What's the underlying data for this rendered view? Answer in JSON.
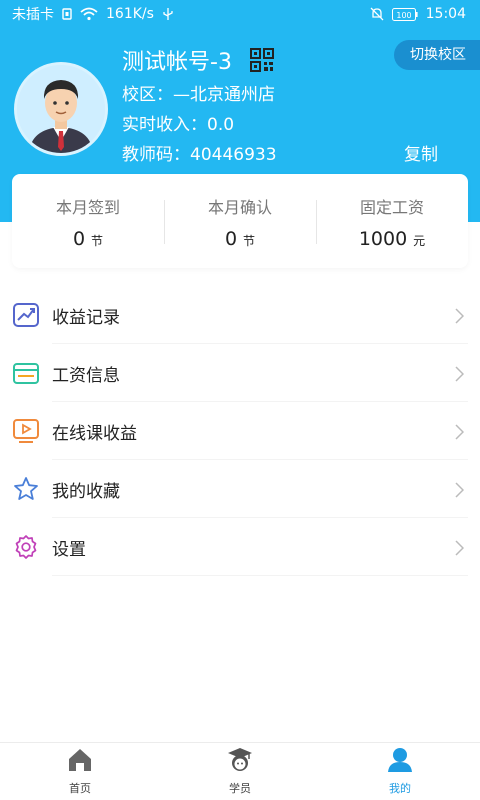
{
  "status_bar": {
    "carrier": "未插卡",
    "speed": "161K/s",
    "battery": "100",
    "time": "15:04",
    "icons": [
      "sim-icon",
      "wifi-icon",
      "usb-icon",
      "mute-icon",
      "battery-icon"
    ]
  },
  "profile": {
    "name": "测试帐号-3",
    "switch_label": "切换校区",
    "campus": "校区：—北京通州店",
    "income": "实时收入：0.0",
    "teacher_code": "教师码：40446933",
    "copy_label": "复制",
    "avatar_icon": "teacher-avatar",
    "qr_icon": "qr-code-icon"
  },
  "stats": [
    {
      "label": "本月签到",
      "value": "0",
      "unit": "节"
    },
    {
      "label": "本月确认",
      "value": "0",
      "unit": "节"
    },
    {
      "label": "固定工资",
      "value": "1000",
      "unit": "元"
    }
  ],
  "menu": [
    {
      "label": "收益记录",
      "icon": "trend-chart-icon"
    },
    {
      "label": "工资信息",
      "icon": "wallet-icon"
    },
    {
      "label": "在线课收益",
      "icon": "video-play-icon"
    },
    {
      "label": "我的收藏",
      "icon": "star-icon"
    },
    {
      "label": "设置",
      "icon": "gear-icon"
    }
  ],
  "tabs": [
    {
      "label": "首页",
      "icon": "home-icon"
    },
    {
      "label": "学员",
      "icon": "student-icon"
    },
    {
      "label": "我的",
      "icon": "user-icon",
      "active": true
    }
  ],
  "colors": {
    "primary": "#23b8f2",
    "switch_bg": "#1a8fd0",
    "tab_active": "#1e9be2"
  }
}
